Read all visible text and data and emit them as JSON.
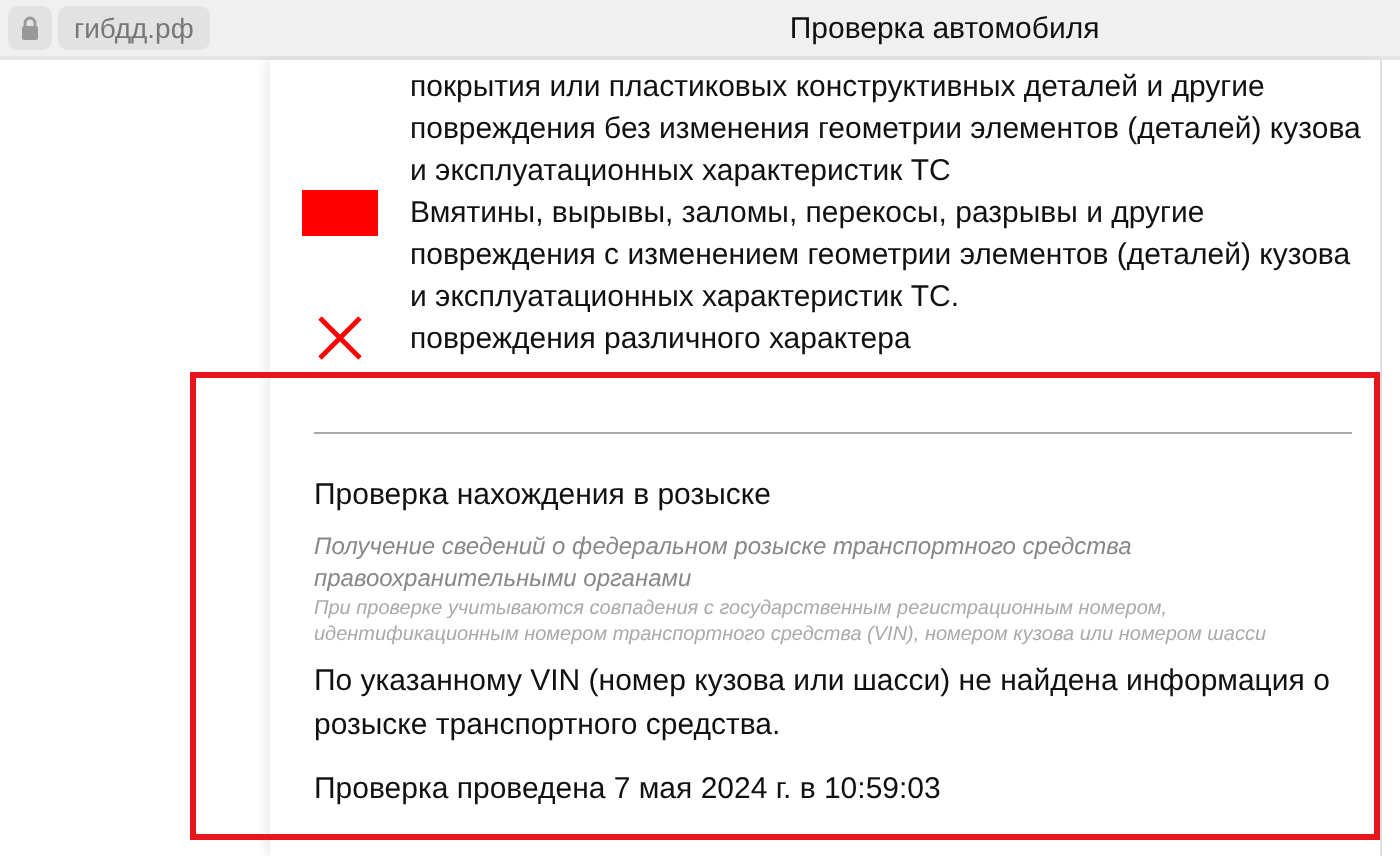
{
  "browser": {
    "domain": "гибдд.рф",
    "title": "Проверка автомобиля"
  },
  "legend": [
    {
      "kind": "none",
      "text": "покрытия или пластиковых конструктивных деталей и другие повреждения без изменения геометрии элементов (деталей) кузова и эксплуатационных характеристик ТС"
    },
    {
      "kind": "swatch",
      "color": "#ff0000",
      "text": "Вмятины, вырывы, заломы, перекосы, разрывы и другие повреждения с изменением геометрии элементов (деталей) кузова и эксплуатационных характеристик ТС."
    },
    {
      "kind": "cross",
      "color": "#ff0000",
      "text": "повреждения различного характера"
    }
  ],
  "wanted_check": {
    "highlighted": true,
    "title": "Проверка нахождения в розыске",
    "description": "Получение сведений о федеральном розыске транспортного средства правоохранительными органами",
    "note": "При проверке учитываются совпадения с государственным регистрационным номером, идентификационным номером транспортного средства (VIN), номером кузова или номером шасси",
    "result": "По указанному VIN (номер кузова или шасси) не найдена информация о розыске транспортного средства.",
    "checked_at": "Проверка проведена 7 мая 2024 г. в 10:59:03"
  }
}
